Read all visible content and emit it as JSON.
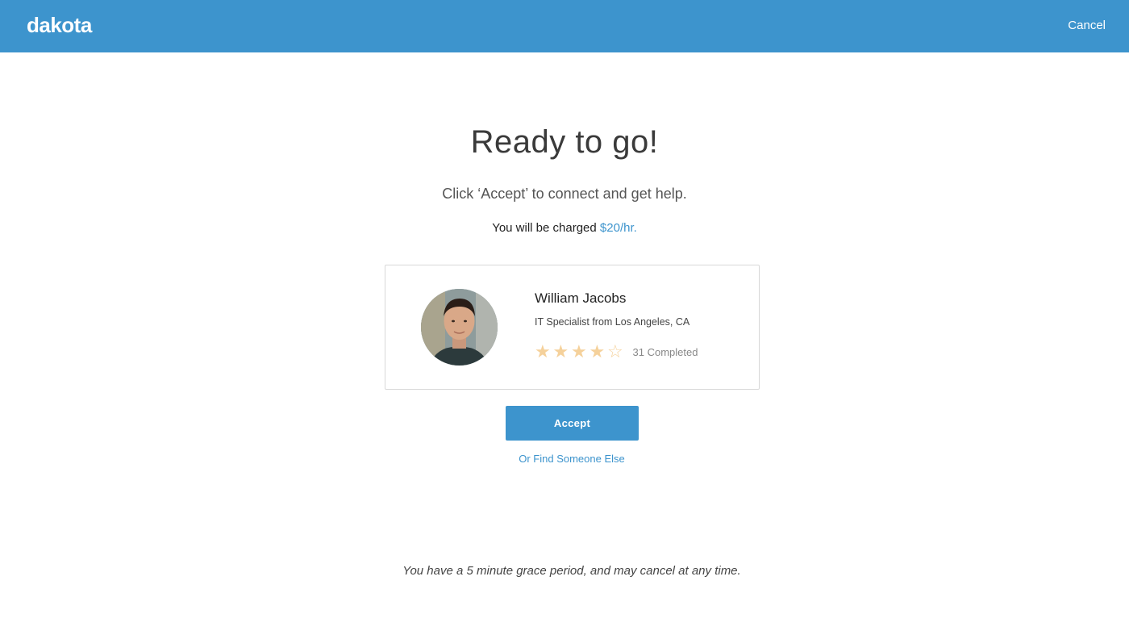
{
  "header": {
    "logo": "dakota",
    "cancel_label": "Cancel",
    "color": "#3d94cd"
  },
  "main": {
    "title": "Ready to go!",
    "subtitle": "Click ‘Accept’ to connect and get help.",
    "charge_prefix": "You will be charged",
    "charge_rate": "$20/hr."
  },
  "specialist": {
    "name": "William Jacobs",
    "role": "IT Specialist from Los Angeles, CA",
    "rating": 4,
    "rating_max": 5,
    "completed": "31 Completed",
    "star_color": "#f5d19b"
  },
  "actions": {
    "accept_label": "Accept",
    "find_label": "Or Find Someone Else"
  },
  "footer": {
    "grace_text": "You have a 5 minute grace period, and may cancel at any time."
  }
}
